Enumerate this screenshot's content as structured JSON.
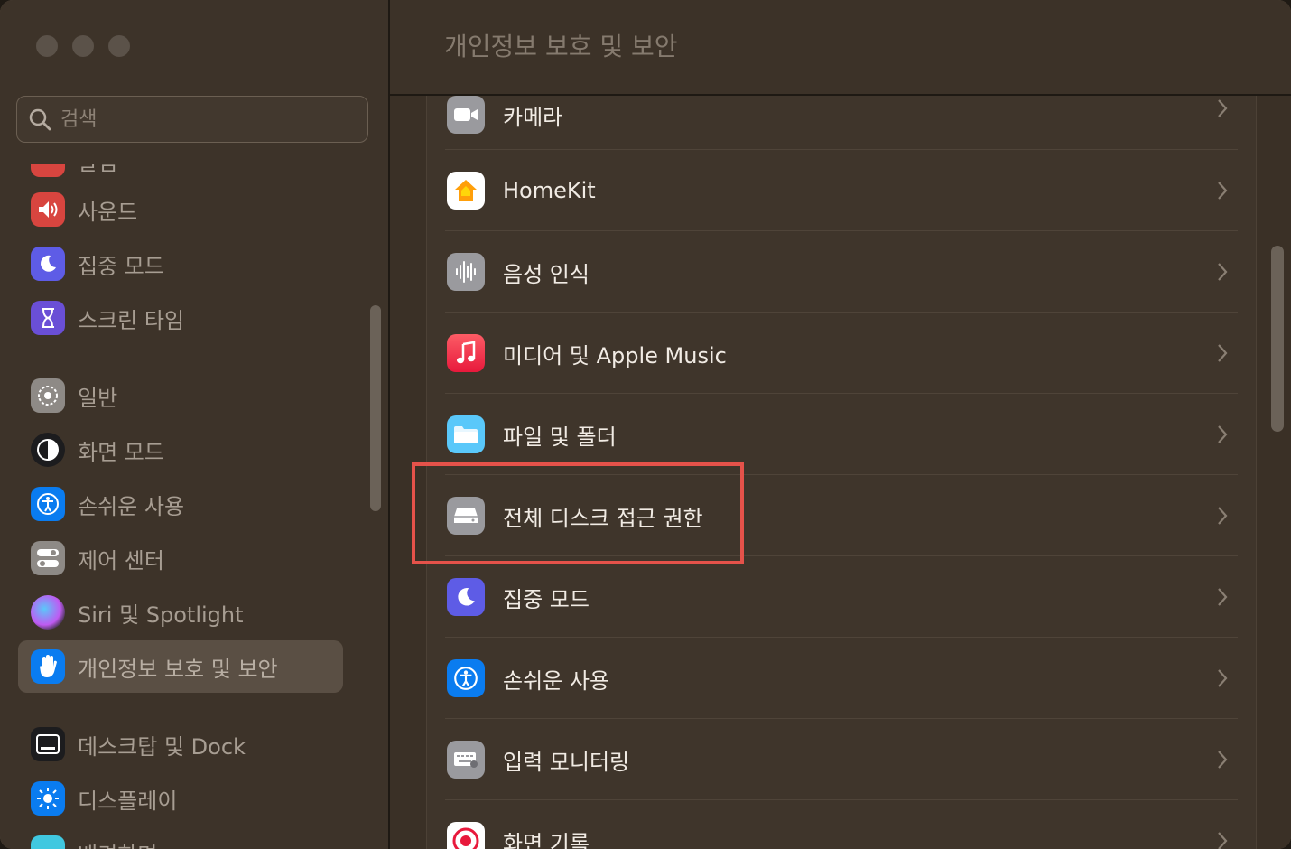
{
  "window": {
    "title": "개인정보 보호 및 보안"
  },
  "search": {
    "placeholder": "검색"
  },
  "sidebar": {
    "items": [
      {
        "label": "알림",
        "icon": "bell-icon",
        "color": "#e0443e"
      },
      {
        "label": "사운드",
        "icon": "speaker-icon",
        "color": "#e0443e"
      },
      {
        "label": "집중 모드",
        "icon": "moon-icon",
        "color": "#5e5ce6"
      },
      {
        "label": "스크린 타임",
        "icon": "hourglass-icon",
        "color": "#6a5acd"
      },
      {
        "label": "일반",
        "icon": "gear-icon",
        "color": "#8e8e93"
      },
      {
        "label": "화면 모드",
        "icon": "appearance-icon",
        "color": "#1c1c1e"
      },
      {
        "label": "손쉬운 사용",
        "icon": "accessibility-icon",
        "color": "#0a84ff"
      },
      {
        "label": "제어 센터",
        "icon": "toggle-icon",
        "color": "#8e8e93"
      },
      {
        "label": "Siri 및 Spotlight",
        "icon": "siri-icon",
        "color": "#bf5af2"
      },
      {
        "label": "개인정보 보호 및 보안",
        "icon": "hand-icon",
        "color": "#0a84ff"
      },
      {
        "label": "데스크탑 및 Dock",
        "icon": "dock-icon",
        "color": "#1c1c1e"
      },
      {
        "label": "디스플레이",
        "icon": "sun-icon",
        "color": "#0a84ff"
      },
      {
        "label": "배경화면",
        "icon": "wallpaper-icon",
        "color": "#40c8e0"
      }
    ]
  },
  "main": {
    "rows": [
      {
        "label": "카메라",
        "icon": "camera-icon",
        "color": "#8e8e93"
      },
      {
        "label": "HomeKit",
        "icon": "home-icon",
        "color": "#ffffff"
      },
      {
        "label": "음성 인식",
        "icon": "waveform-icon",
        "color": "#8e8e93"
      },
      {
        "label": "미디어 및 Apple Music",
        "icon": "music-note-icon",
        "color": "#fc3c44"
      },
      {
        "label": "파일 및 폴더",
        "icon": "folder-icon",
        "color": "#5ac8fa"
      },
      {
        "label": "전체 디스크 접근 권한",
        "icon": "disk-icon",
        "color": "#8e8e93"
      },
      {
        "label": "집중 모드",
        "icon": "moon-icon",
        "color": "#5e5ce6"
      },
      {
        "label": "손쉬운 사용",
        "icon": "accessibility-icon",
        "color": "#0a84ff"
      },
      {
        "label": "입력 모니터링",
        "icon": "keyboard-icon",
        "color": "#8e8e93"
      },
      {
        "label": "화면 기록",
        "icon": "record-icon",
        "color": "#ffffff"
      }
    ]
  },
  "highlight": {
    "color": "#e5524a"
  }
}
